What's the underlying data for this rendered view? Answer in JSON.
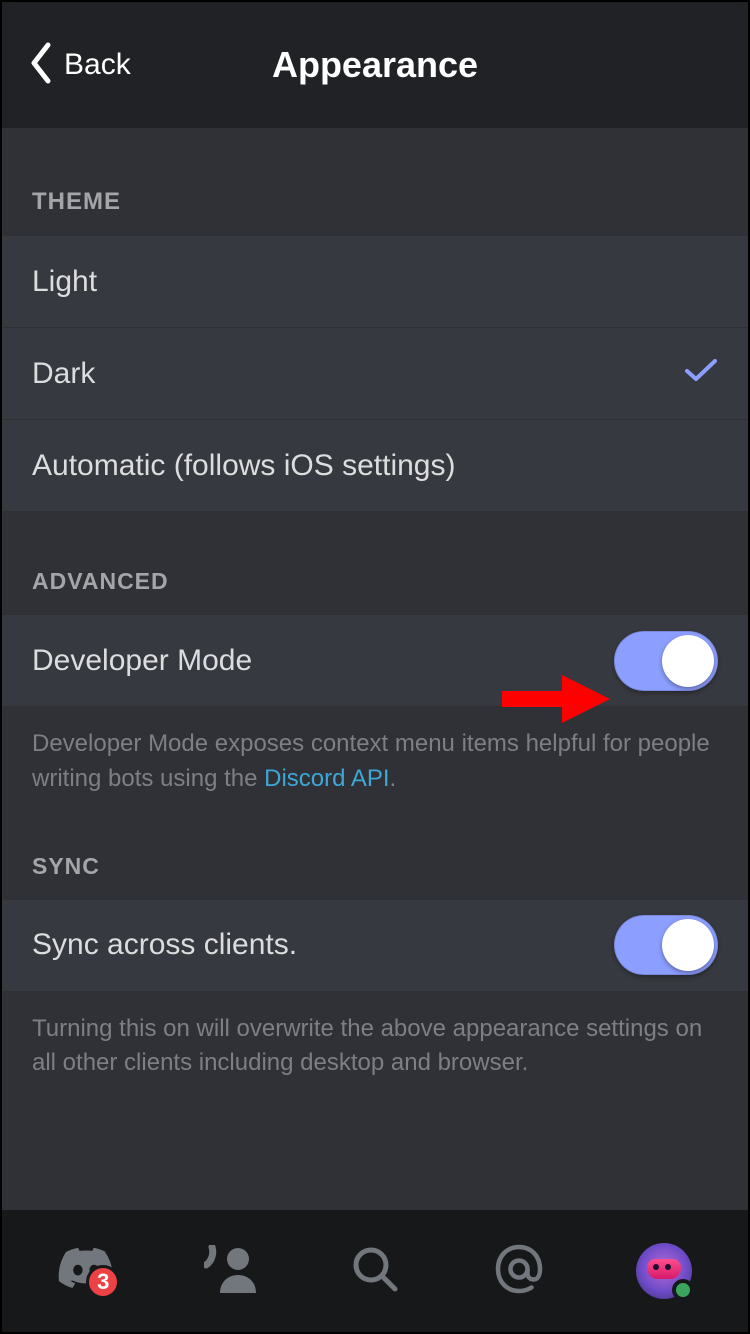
{
  "header": {
    "back_label": "Back",
    "title": "Appearance"
  },
  "sections": {
    "theme": {
      "header": "THEME",
      "options": [
        {
          "label": "Light",
          "selected": false
        },
        {
          "label": "Dark",
          "selected": true
        },
        {
          "label": "Automatic (follows iOS settings)",
          "selected": false
        }
      ]
    },
    "advanced": {
      "header": "ADVANCED",
      "developer_mode": {
        "label": "Developer Mode",
        "enabled": true,
        "description_pre": "Developer Mode exposes context menu items helpful for people writing bots using the ",
        "link_label": "Discord API",
        "description_post": "."
      }
    },
    "sync": {
      "header": "SYNC",
      "sync_clients": {
        "label": "Sync across clients.",
        "enabled": true,
        "description": "Turning this on will overwrite the above appearance settings on all other clients including desktop and browser."
      }
    }
  },
  "tabbar": {
    "badge_count": "3"
  },
  "colors": {
    "accent": "#8c9eff",
    "bg_dark": "#202225",
    "bg": "#2f3136",
    "bg_row": "#36393f",
    "link": "#3fa7d6",
    "danger": "#ed4245",
    "online": "#3ba55d"
  }
}
